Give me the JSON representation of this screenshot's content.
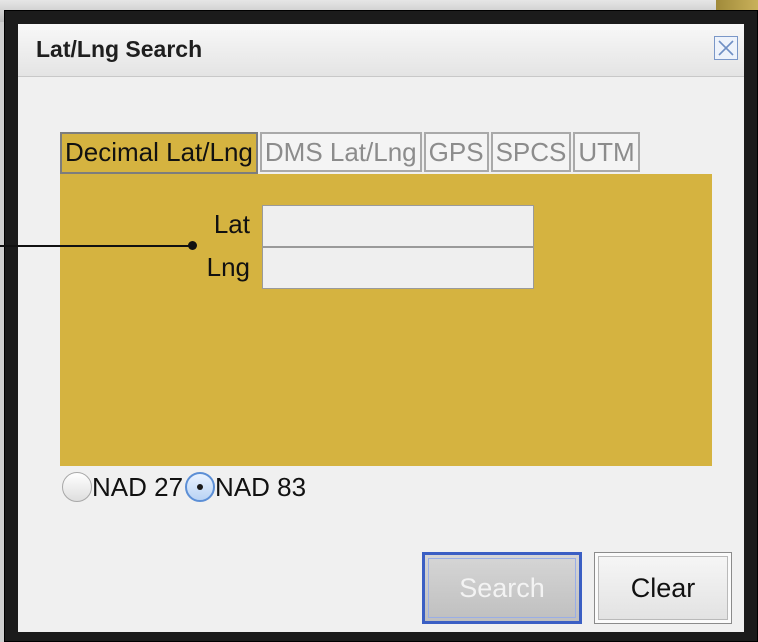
{
  "dialog": {
    "title": "Lat/Lng Search",
    "close_icon": "close-x-icon"
  },
  "tabs": [
    {
      "label": "Decimal Lat/Lng",
      "active": true
    },
    {
      "label": "DMS Lat/Lng",
      "active": false
    },
    {
      "label": "GPS",
      "active": false
    },
    {
      "label": "SPCS",
      "active": false
    },
    {
      "label": "UTM",
      "active": false
    }
  ],
  "form": {
    "lat_label": "Lat",
    "lat_value": "",
    "lng_label": "Lng",
    "lng_value": ""
  },
  "datum": {
    "options": [
      {
        "label": "NAD 27",
        "checked": false
      },
      {
        "label": "NAD 83",
        "checked": true
      }
    ]
  },
  "buttons": {
    "search_label": "Search",
    "clear_label": "Clear"
  },
  "colors": {
    "panel": "#d5b340",
    "dialog_border": "#1b1b1b",
    "focus_accent": "#3b5fc4"
  }
}
